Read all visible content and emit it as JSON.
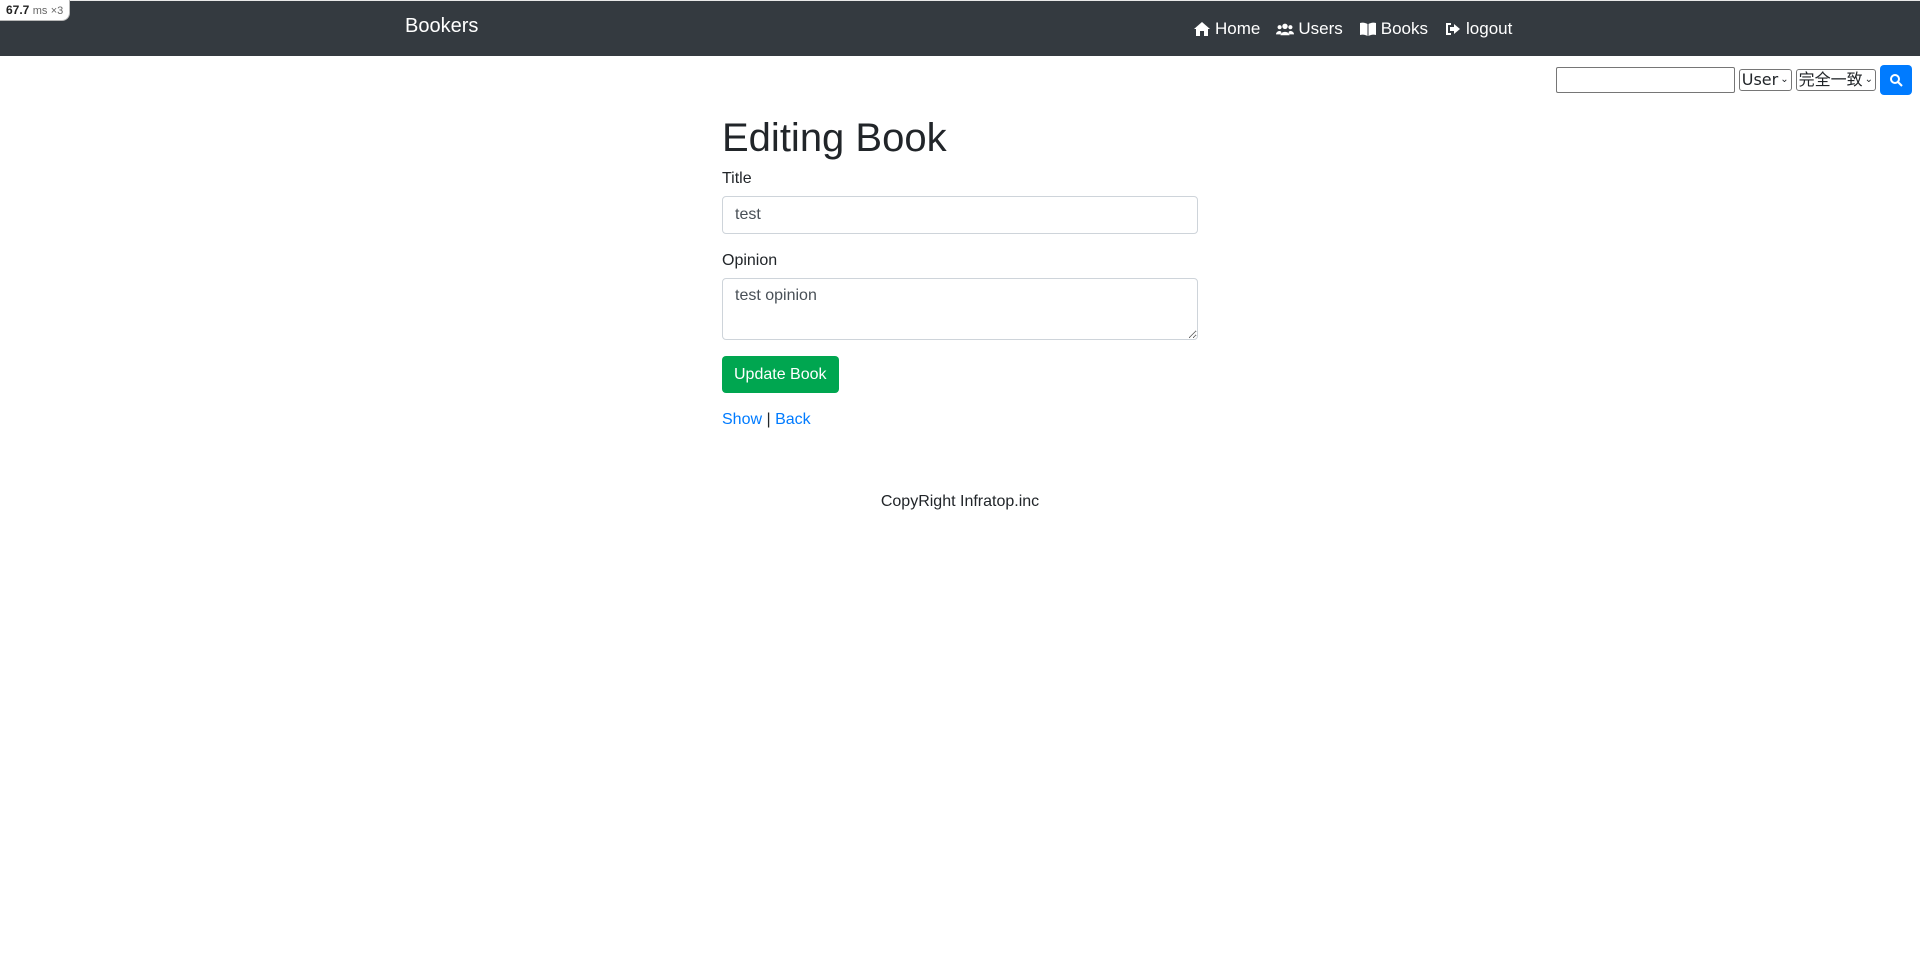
{
  "perf_badge": {
    "value": "67.7",
    "unit": "ms",
    "multiplier": "×3"
  },
  "navbar": {
    "brand": "Bookers",
    "links": [
      {
        "label": "Home",
        "icon": "home-icon"
      },
      {
        "label": "Users",
        "icon": "users-icon"
      },
      {
        "label": "Books",
        "icon": "book-open-icon"
      },
      {
        "label": "logout",
        "icon": "sign-out-icon"
      }
    ]
  },
  "search": {
    "query": "",
    "model_select": "User",
    "match_select": "完全一致",
    "button_icon": "search-icon"
  },
  "form": {
    "heading": "Editing Book",
    "title_label": "Title",
    "title_value": "test",
    "opinion_label": "Opinion",
    "opinion_value": "test opinion",
    "submit_label": "Update Book"
  },
  "links": {
    "show": "Show",
    "separator": "|",
    "back": "Back"
  },
  "footer": {
    "text": "CopyRight Infratop.inc"
  },
  "colors": {
    "navbar": "#343a40",
    "success": "#00a650",
    "primary": "#007bff"
  }
}
